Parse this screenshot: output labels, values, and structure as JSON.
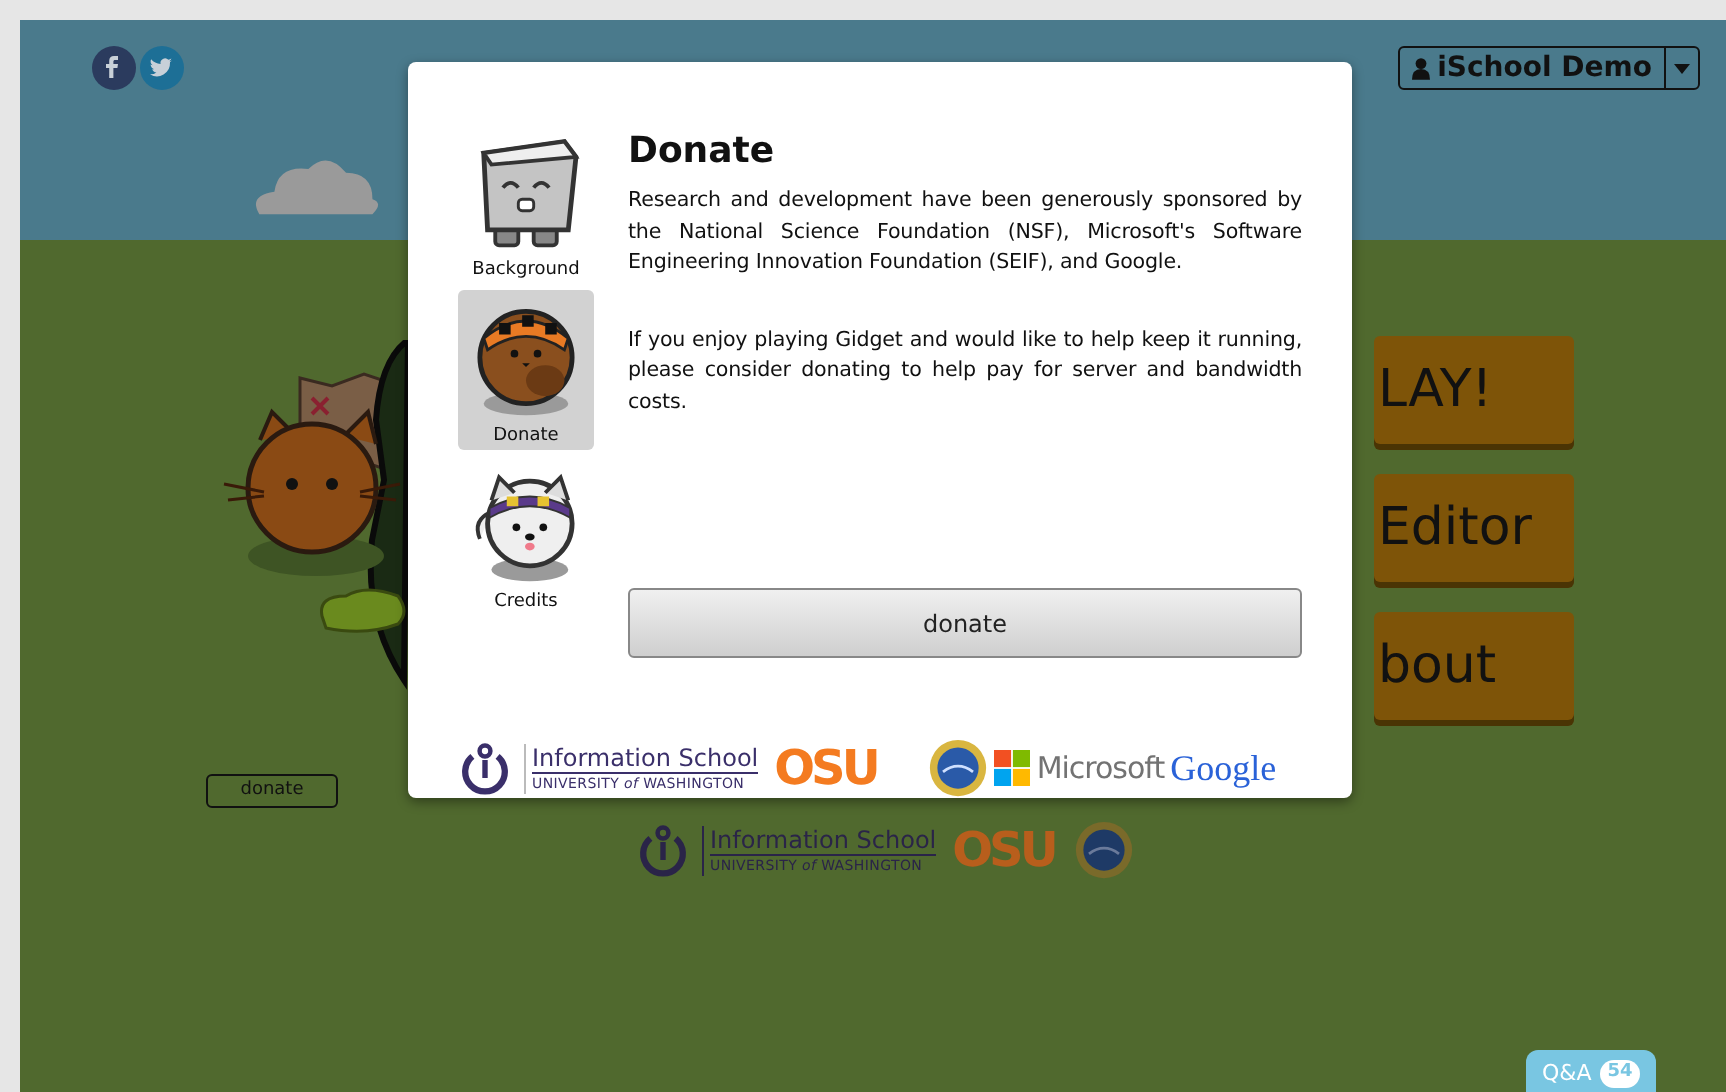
{
  "social": [
    {
      "kind": "facebook"
    },
    {
      "kind": "twitter"
    }
  ],
  "user_menu": {
    "label": "iSchool Demo"
  },
  "menu_buttons": [
    "LAY!",
    "Editor",
    "bout"
  ],
  "page_donate_button": "donate",
  "page_logos": {
    "school": "Information School",
    "university": "UNIVERSITY *of* WASHINGTON",
    "osu": "OSU"
  },
  "qa": {
    "label": "Q&A",
    "count": "54"
  },
  "dialog": {
    "tabs": [
      {
        "label": "Background",
        "kind": "block",
        "selected": false
      },
      {
        "label": "Donate",
        "kind": "bear",
        "selected": true
      },
      {
        "label": "Credits",
        "kind": "dog",
        "selected": false
      }
    ],
    "title": "Donate",
    "paragraphs": [
      "Research and development have been generously sponsored by the National Science Foundation (NSF), Microsoft's Software Engineering Innovation Foundation (SEIF), and Google.",
      "If you enjoy playing Gidget and would like to help keep it running, please consider donating to help pay for server and bandwidth costs."
    ],
    "button": "donate",
    "sponsors": {
      "school": "Information School",
      "university": "UNIVERSITY *of* WASHINGTON",
      "osu": "OSU",
      "microsoft": "Microsoft",
      "google": "Google"
    }
  }
}
